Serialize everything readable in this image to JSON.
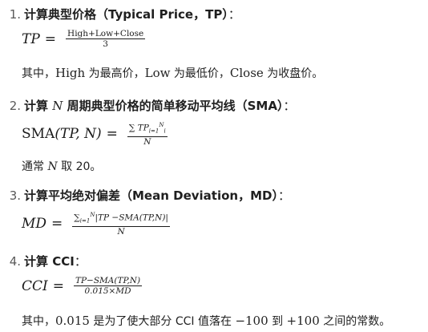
{
  "steps": [
    {
      "number": "1.",
      "title_cn": "计算典型价格（Typical Price，TP）",
      "title_tail": "：",
      "formula": {
        "lhs": "TP",
        "eq": "=",
        "numerator": "High+Low+Close",
        "denominator": "3"
      },
      "note": {
        "prefix": "其中，",
        "high": "High",
        "high_desc": " 为最高价，",
        "low": "Low",
        "low_desc": " 为最低价，",
        "close": "Close",
        "close_desc": " 为收盘价。"
      }
    },
    {
      "number": "2.",
      "title_a": "计算 ",
      "title_var": "N",
      "title_b": " 周期典型价格的简单移动平均线（SMA）",
      "title_tail": "：",
      "formula": {
        "lhs_fn": "SMA",
        "lhs_args": "(TP, N)",
        "eq": "=",
        "numerator": "∑ TP",
        "sum_lower": "i=1",
        "sum_upper": "N",
        "sub_i": "i",
        "denominator": "N"
      },
      "note": {
        "prefix": "通常 ",
        "var": "N",
        "suffix": " 取 20。"
      }
    },
    {
      "number": "3.",
      "title_cn": "计算平均绝对偏差（Mean Deviation，MD）",
      "title_tail": "：",
      "formula": {
        "lhs": "MD",
        "eq": "=",
        "numerator": "|TP −SMA(TP,N)|",
        "sum_lower": "i=1",
        "sum_upper": "N",
        "sub_i": "i",
        "denominator": "N"
      }
    },
    {
      "number": "4.",
      "title_cn": "计算 CCI",
      "title_tail": "：",
      "formula": {
        "lhs": "CCI",
        "eq": "=",
        "numerator": "TP−SMA(TP,N)",
        "denominator": "0.015×MD"
      },
      "note": {
        "prefix": "其中，",
        "const": "0.015",
        "mid": " 是为了使大部分 CCI 值落在 ",
        "low": "−100",
        "to": " 到 ",
        "high": "+100",
        "suffix": " 之间的常数。"
      }
    }
  ]
}
